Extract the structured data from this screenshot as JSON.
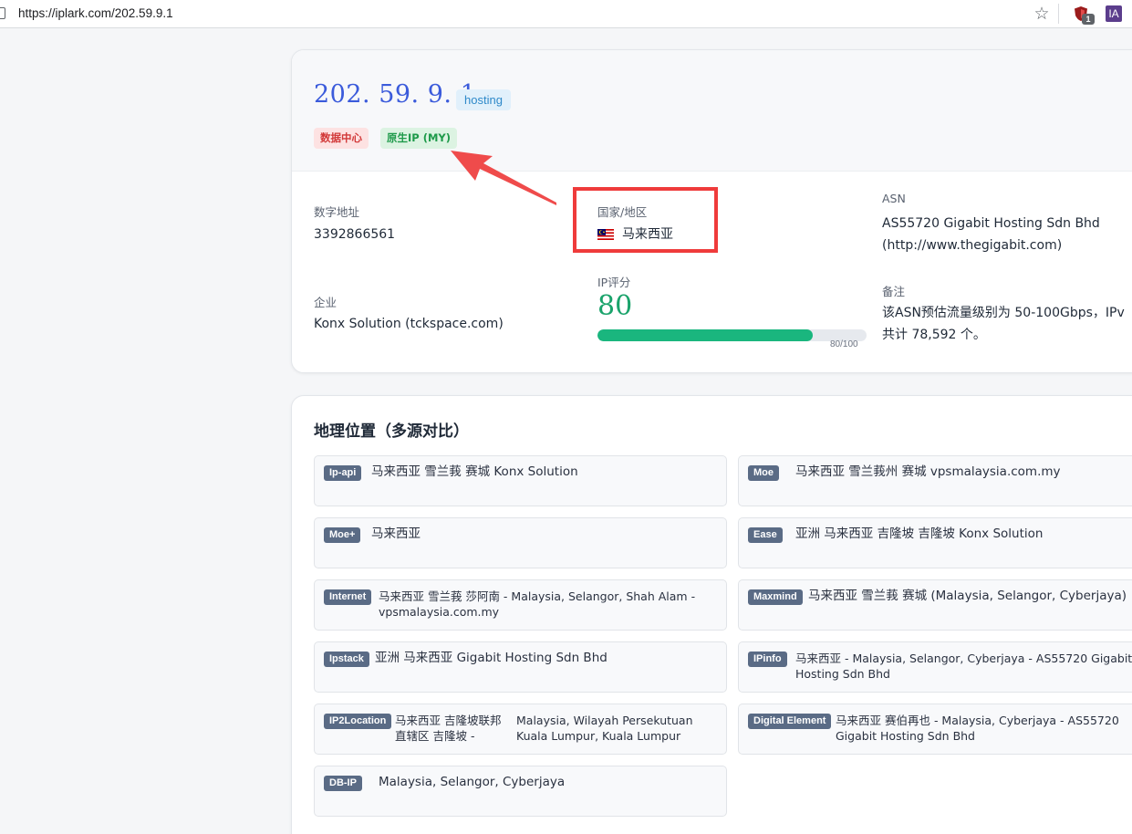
{
  "browser": {
    "url": "https://iplark.com/202.59.9.1",
    "extension_badge": "1",
    "extension_ia_label": "IA"
  },
  "summary": {
    "ip": "202. 59. 9. 1",
    "type_pill": "hosting",
    "tags": [
      "数据中心",
      "原生IP (MY)"
    ],
    "numeric_label": "数字地址",
    "numeric_value": "3392866561",
    "country_label": "国家/地区",
    "country_value": "马来西亚",
    "asn_label": "ASN",
    "asn_value_1": "AS55720 Gigabit Hosting Sdn Bhd",
    "asn_value_2": "(http://www.thegigabit.com)",
    "company_label": "企业",
    "company_value": "Konx Solution (tckspace.com)",
    "score_label": "IP评分",
    "score_value": "80",
    "score_fraction": 0.8,
    "score_max_text": "80/100",
    "note_label": "备注",
    "note_line_1": "该ASN预估流量级别为 50-100Gbps，IPv",
    "note_line_2": "共计 78,592 个。"
  },
  "geo": {
    "title": "地理位置（多源对比）",
    "sources": [
      {
        "name": "Ip-api",
        "text": "马来西亚 雪兰莪 赛城 Konx Solution"
      },
      {
        "name": "Moe",
        "text": "马来西亚 雪兰莪州 赛城 vpsmalaysia.com.my"
      },
      {
        "name": "Moe+",
        "text": "马来西亚"
      },
      {
        "name": "Ease",
        "text": "亚洲 马来西亚 吉隆坡 吉隆坡 Konx Solution"
      },
      {
        "name": "Internet",
        "text_1": "马来西亚 雪兰莪 莎阿南 - Malaysia, Selangor, Shah Alam -",
        "text_2": "vpsmalaysia.com.my"
      },
      {
        "name": "Maxmind",
        "text": "马来西亚 雪兰莪 赛城 (Malaysia, Selangor, Cyberjaya)"
      },
      {
        "name": "Ipstack",
        "text": "亚洲 马来西亚 Gigabit Hosting Sdn Bhd"
      },
      {
        "name": "IPinfo",
        "text_1": "马来西亚 - Malaysia, Selangor, Cyberjaya - AS55720 Gigabit",
        "text_2": "Hosting Sdn Bhd"
      },
      {
        "name": "IP2Location",
        "text_1": "马来西亚 吉隆坡联邦",
        "text_2": "直辖区 吉隆坡 -",
        "text_3": "Malaysia, Wilayah Persekutuan",
        "text_4": "Kuala Lumpur, Kuala Lumpur"
      },
      {
        "name": "Digital Element",
        "text_1": "马来西亚 赛伯再也 - Malaysia, Cyberjaya - AS55720",
        "text_2": "Gigabit Hosting Sdn Bhd"
      },
      {
        "name": "DB-IP",
        "text": "Malaysia, Selangor, Cyberjaya"
      }
    ]
  }
}
